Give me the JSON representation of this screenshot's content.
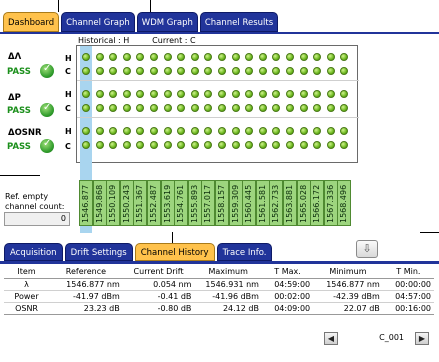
{
  "top_tabs": [
    {
      "label": "Dashboard"
    },
    {
      "label": "Channel Graph"
    },
    {
      "label": "WDM Graph"
    },
    {
      "label": "Channel Results"
    }
  ],
  "historical_label": "Historical : H",
  "current_label": "Current : C",
  "metrics": [
    {
      "name": "ΔΛ",
      "status": "PASS"
    },
    {
      "name": "ΔP",
      "status": "PASS"
    },
    {
      "name": "ΔOSNR",
      "status": "PASS"
    }
  ],
  "row_labels": {
    "h": "H",
    "c": "C"
  },
  "channels": [
    "1546.877",
    "1549.868",
    "1550.109",
    "1550.243",
    "1551.367",
    "1552.487",
    "1553.619",
    "1554.761",
    "1555.893",
    "1557.017",
    "1558.157",
    "1559.309",
    "1560.445",
    "1561.581",
    "1562.733",
    "1563.881",
    "1565.028",
    "1566.172",
    "1567.336",
    "1568.496"
  ],
  "ref_empty": {
    "label_line1": "Ref. empty",
    "label_line2": "channel count:",
    "value": "0"
  },
  "bottom_tabs": [
    {
      "label": "Acquisition"
    },
    {
      "label": "Drift Settings"
    },
    {
      "label": "Channel History"
    },
    {
      "label": "Trace Info."
    }
  ],
  "table": {
    "headers": [
      "Item",
      "Reference",
      "Current Drift",
      "Maximum",
      "T Max.",
      "Minimum",
      "T Min."
    ],
    "rows": [
      [
        "λ",
        "1546.877 nm",
        "0.054 nm",
        "1546.931 nm",
        "04:59:00",
        "1546.877 nm",
        "00:00:00"
      ],
      [
        "Power",
        "-41.97 dBm",
        "-0.41 dB",
        "-41.96 dBm",
        "00:02:00",
        "-42.39 dBm",
        "04:57:00"
      ],
      [
        "OSNR",
        "23.23 dB",
        "-0.80 dB",
        "24.12 dB",
        "04:09:00",
        "22.07 dB",
        "00:16:00"
      ]
    ]
  },
  "nav": {
    "value": "C_001"
  },
  "icons": {
    "scroll": "down-arrow-icon",
    "prev": "triangle-left-icon",
    "next": "triangle-right-icon",
    "pass": "check-circle-icon"
  },
  "colors": {
    "tab_blue": "#21349a",
    "tab_active": "#ffc24c",
    "pass_green": "#1b8f1b",
    "channel_fill": "#9dd57e",
    "highlight_col": "#a9d5ef"
  }
}
